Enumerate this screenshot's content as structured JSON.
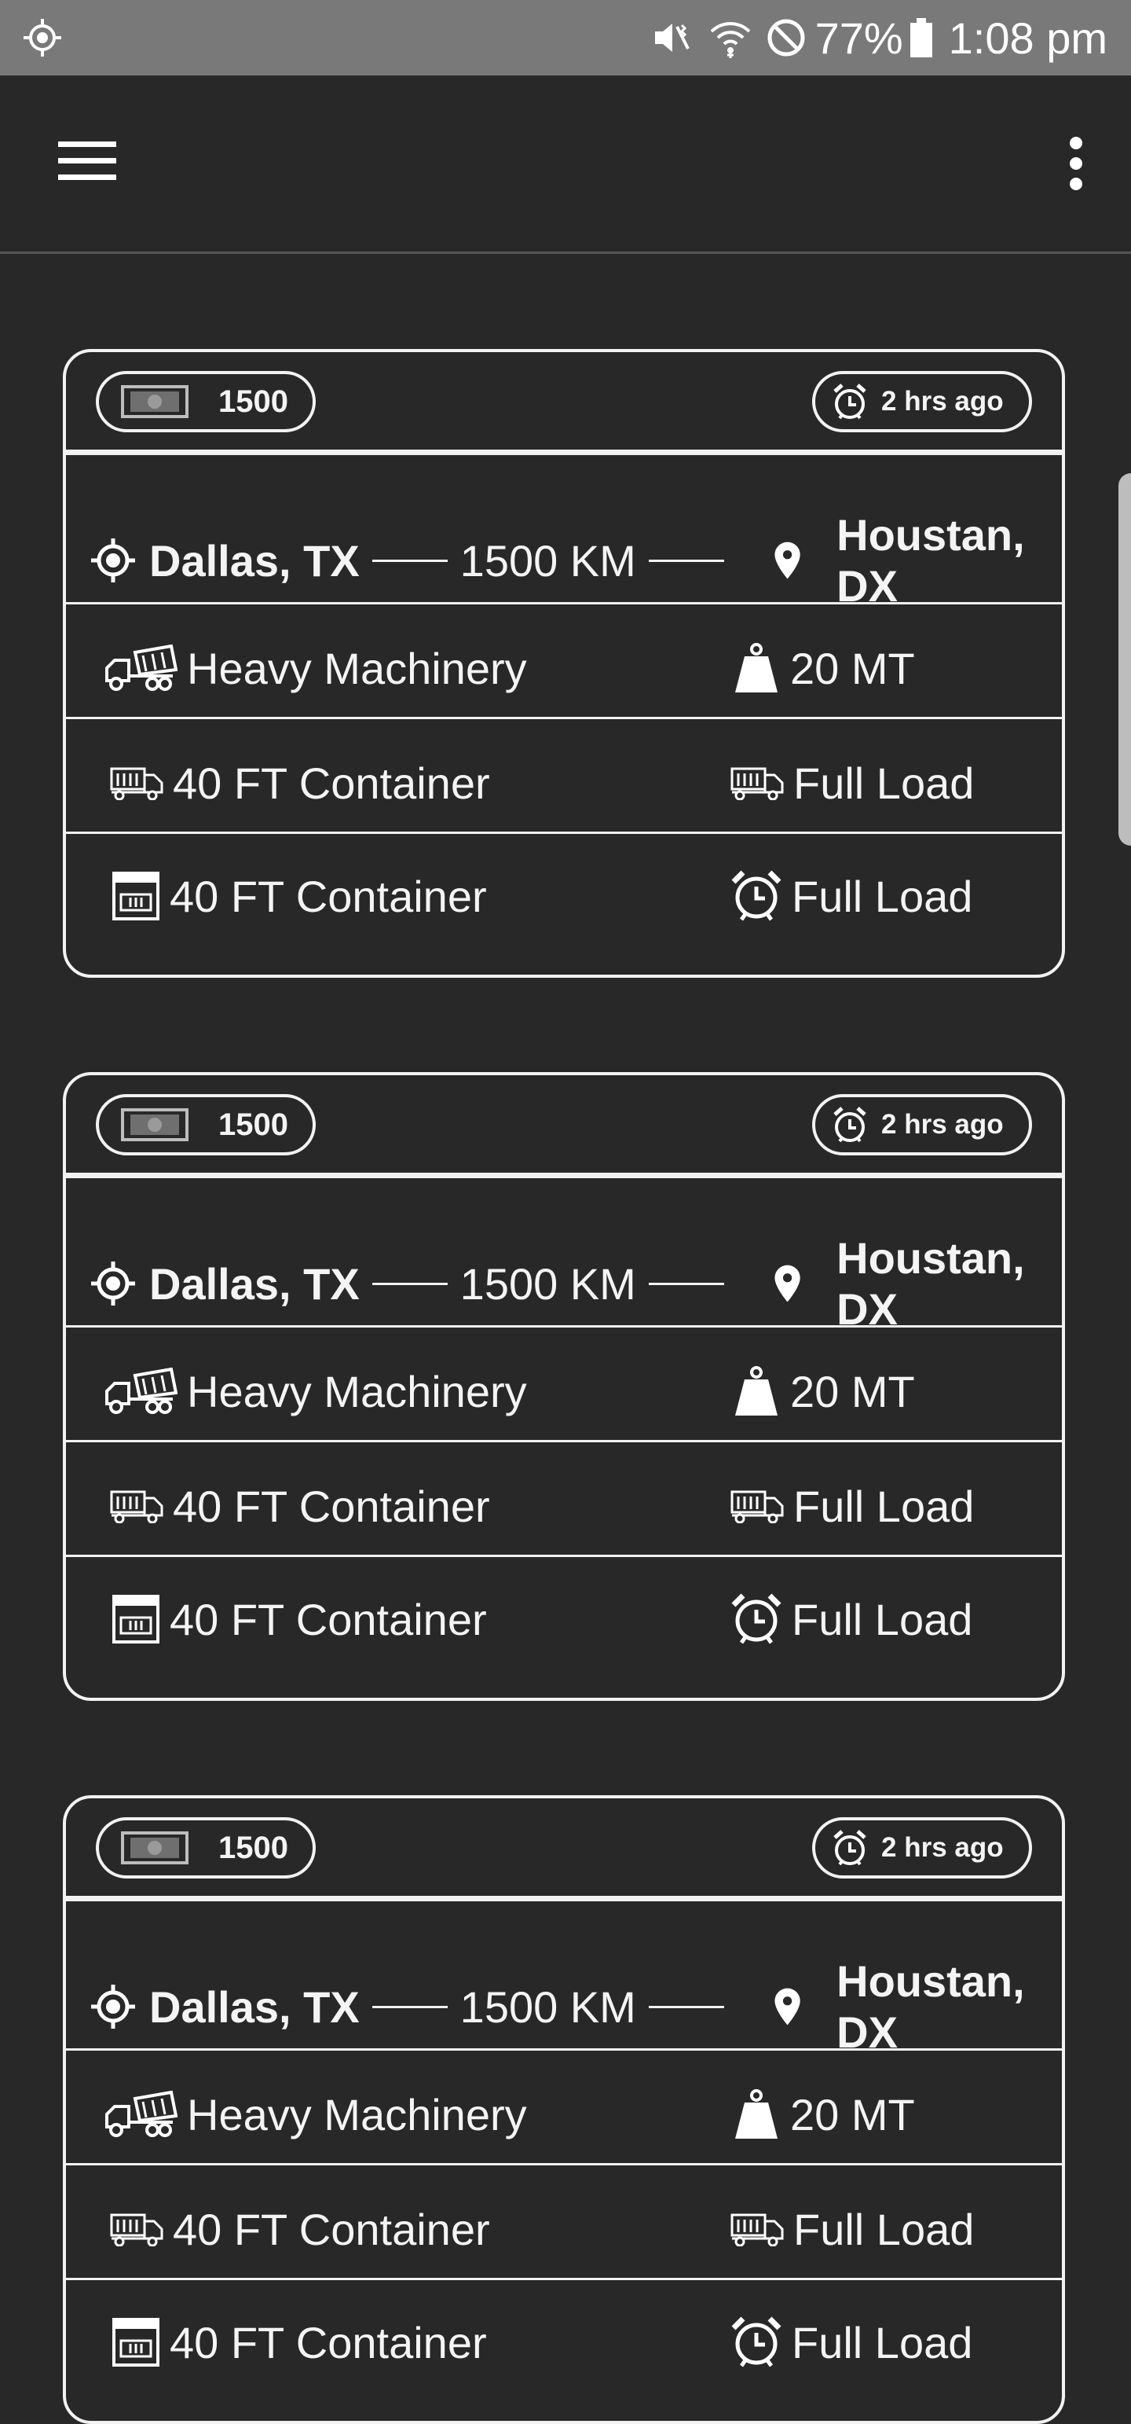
{
  "status_bar": {
    "battery": "77%",
    "time": "1:08 pm",
    "icons": [
      "location-icon",
      "mute-vibrate-icon",
      "wifi-icon",
      "do-not-disturb-icon",
      "battery-icon"
    ]
  },
  "app_bar": {
    "menu_icon": "hamburger-menu-icon",
    "overflow_icon": "more-vert-icon"
  },
  "cards": [
    {
      "price": "1500",
      "posted": "2 hrs ago",
      "origin": "Dallas, TX",
      "distance": "1500 KM",
      "destination": "Houstan, DX",
      "goods": "Heavy Machinery",
      "weight": "20 MT",
      "vehicle": "40 FT Container",
      "load_type": "Full Load",
      "container": "40 FT Container",
      "schedule": "Full Load"
    },
    {
      "price": "1500",
      "posted": "2 hrs ago",
      "origin": "Dallas, TX",
      "distance": "1500 KM",
      "destination": "Houstan, DX",
      "goods": "Heavy Machinery",
      "weight": "20 MT",
      "vehicle": "40 FT Container",
      "load_type": "Full Load",
      "container": "40 FT Container",
      "schedule": "Full Load"
    },
    {
      "price": "1500",
      "posted": "2 hrs ago",
      "origin": "Dallas, TX",
      "distance": "1500 KM",
      "destination": "Houstan, DX",
      "goods": "Heavy Machinery",
      "weight": "20 MT",
      "vehicle": "40 FT Container",
      "load_type": "Full Load",
      "container": "40 FT Container",
      "schedule": "Full Load"
    }
  ]
}
